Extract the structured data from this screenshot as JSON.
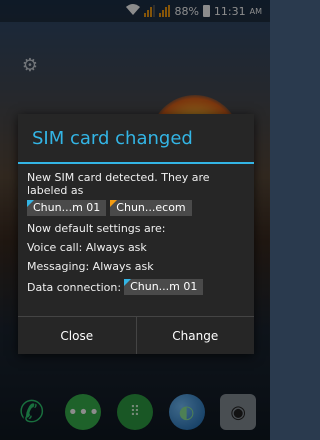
{
  "status_bar": {
    "battery": "88%",
    "time": "11:31",
    "ampm": "AM",
    "wifi_icon": "wifi-icon",
    "signal_icons": [
      "signal-icon-sim1",
      "signal-icon-sim2"
    ]
  },
  "dialog": {
    "title": "SIM card changed",
    "message": "New SIM card detected. They are labeled as",
    "sims": [
      {
        "label": "Chun...m 01",
        "color": "#33b5e5"
      },
      {
        "label": "Chun...ecom",
        "color": "#f39c12"
      }
    ],
    "defaults_heading": "Now default settings are:",
    "voice_label": "Voice call:",
    "voice_value": "Always ask",
    "messaging_label": "Messaging:",
    "messaging_value": "Always ask",
    "data_label": "Data connection:",
    "data_value": "Chun...m 01",
    "close_label": "Close",
    "change_label": "Change"
  },
  "dock": {
    "icons": [
      "phone-icon",
      "messaging-icon",
      "apps-icon",
      "browser-icon",
      "camera-icon"
    ]
  },
  "colors": {
    "accent": "#33b5e5",
    "sim2": "#f39c12"
  }
}
